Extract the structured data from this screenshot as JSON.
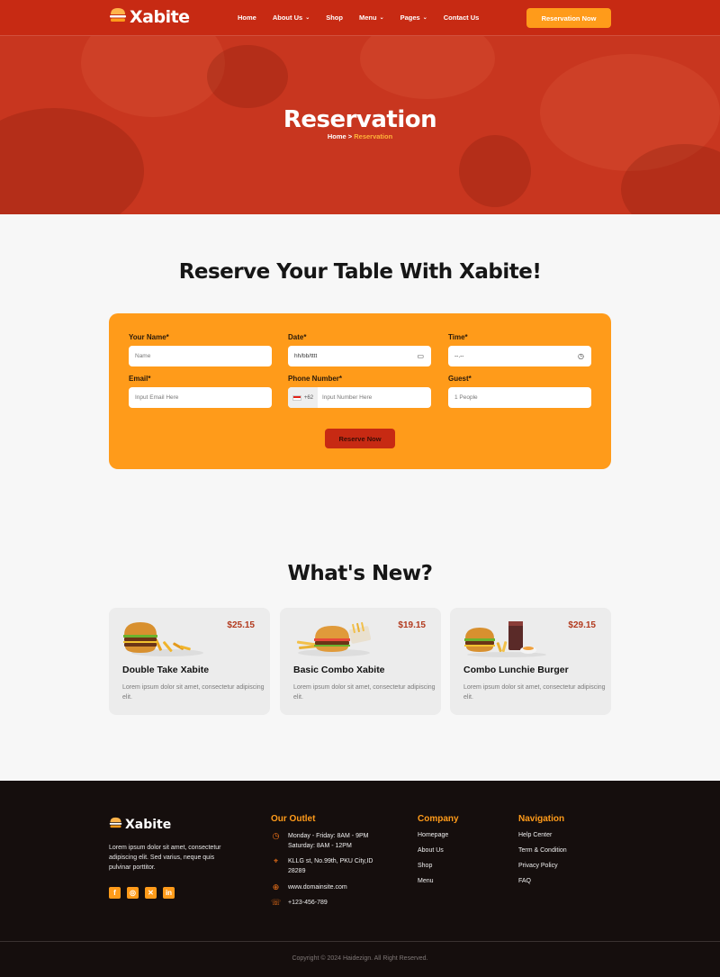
{
  "brand": {
    "name": "Xabite",
    "color": "#c72a13",
    "accent": "#ff9b1a"
  },
  "nav": {
    "items": [
      {
        "label": "Home",
        "dropdown": false
      },
      {
        "label": "About Us",
        "dropdown": true
      },
      {
        "label": "Shop",
        "dropdown": false
      },
      {
        "label": "Menu",
        "dropdown": true
      },
      {
        "label": "Pages",
        "dropdown": true
      },
      {
        "label": "Contact Us",
        "dropdown": false
      }
    ],
    "cta_label": "Reservation Now"
  },
  "hero": {
    "title": "Reservation",
    "breadcrumb_home": "Home",
    "breadcrumb_sep": " > ",
    "breadcrumb_current": "Reservation"
  },
  "reservation": {
    "heading": "Reserve Your Table With Xabite!",
    "fields": {
      "name": {
        "label": "Your Name*",
        "placeholder": "Name"
      },
      "date": {
        "label": "Date*",
        "value": "hh/bb/tttt"
      },
      "time": {
        "label": "Time*",
        "value": "--.--"
      },
      "email": {
        "label": "Email*",
        "placeholder": "Input Email Here"
      },
      "phone": {
        "label": "Phone Number*",
        "code": "+62",
        "placeholder": "Input Number Here"
      },
      "guest": {
        "label": "Guest*",
        "value": "1 People"
      }
    },
    "submit_label": "Reserve Now"
  },
  "whats_new": {
    "heading": "What's New?",
    "items": [
      {
        "name": "Double Take Xabite",
        "price": "$25.15",
        "desc": "Lorem ipsum dolor sit amet, consectetur adipiscing elit."
      },
      {
        "name": "Basic Combo Xabite",
        "price": "$19.15",
        "desc": "Lorem ipsum dolor sit amet, consectetur adipiscing elit."
      },
      {
        "name": "Combo Lunchie Burger",
        "price": "$29.15",
        "desc": "Lorem ipsum dolor sit amet, consectetur adipiscing elit."
      }
    ]
  },
  "footer": {
    "about": "Lorem ipsum dolor sit amet, consectetur adipiscing elit. Sed varius, neque quis pulvinar porttitor.",
    "socials": [
      "facebook-icon",
      "instagram-icon",
      "x-icon",
      "linkedin-icon"
    ],
    "outlet": {
      "heading": "Our Outlet",
      "hours_1": "Monday - Friday: 8AM - 9PM",
      "hours_2": "Saturday: 8AM - 12PM",
      "address_1": "KLLG st, No.99th, PKU City,ID",
      "address_2": "28289",
      "website": "www.domainsite.com",
      "phone": "+123-456-789"
    },
    "company": {
      "heading": "Company",
      "links": [
        "Homepage",
        "About Us",
        "Shop",
        "Menu"
      ]
    },
    "navigation": {
      "heading": "Navigation",
      "links": [
        "Help Center",
        "Term & Condition",
        "Privacy Policy",
        "FAQ"
      ]
    },
    "copyright": "Copyright © 2024 Haidezign. All Right Reserved."
  }
}
